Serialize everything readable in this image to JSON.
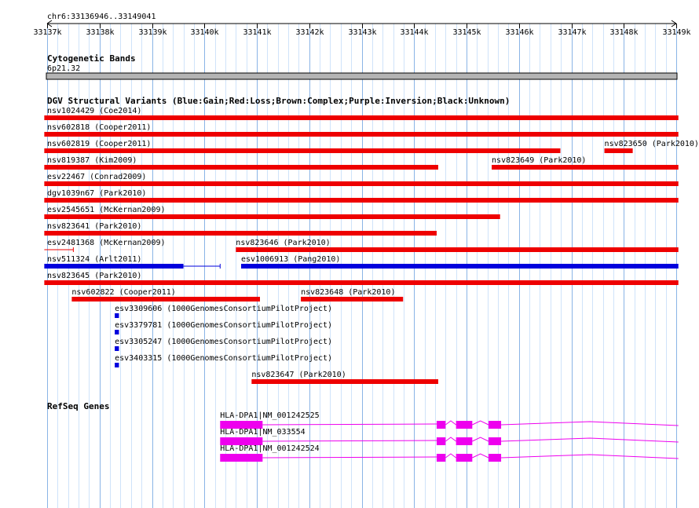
{
  "ruler": {
    "location": "chr6:33136946..33149041",
    "range": [
      33137000,
      33149000
    ],
    "ticks": [
      "33137k",
      "33138k",
      "33139k",
      "33140k",
      "33141k",
      "33142k",
      "33143k",
      "33144k",
      "33145k",
      "33146k",
      "33147k",
      "33148k",
      "33149k"
    ]
  },
  "cytoband": {
    "title": "Cytogenetic Bands",
    "band": "6p21.32"
  },
  "dgv": {
    "title": "DGV Structural Variants (Blue:Gain;Red:Loss;Brown:Complex;Purple:Inversion;Black:Unknown)",
    "colors": {
      "loss": "#ee0000",
      "gain": "#0000dd"
    },
    "variants": [
      {
        "label": "nsv1024429 (Coe2014)",
        "start": 33136946,
        "end": 33149041,
        "type": "loss",
        "row": 0
      },
      {
        "label": "nsv602818 (Cooper2011)",
        "start": 33136946,
        "end": 33149041,
        "type": "loss",
        "row": 1
      },
      {
        "label": "nsv602819 (Cooper2011)",
        "start": 33136946,
        "end": 33146790,
        "type": "loss",
        "row": 2
      },
      {
        "label": "nsv823650 (Park2010)",
        "start": 33147630,
        "end": 33148170,
        "type": "loss",
        "row": 2
      },
      {
        "label": "nsv819387 (Kim2009)",
        "start": 33136946,
        "end": 33144460,
        "type": "loss",
        "row": 3
      },
      {
        "label": "nsv823649 (Park2010)",
        "start": 33145480,
        "end": 33149041,
        "type": "loss",
        "row": 3
      },
      {
        "label": "esv22467 (Conrad2009)",
        "start": 33136946,
        "end": 33149041,
        "type": "loss",
        "row": 4
      },
      {
        "label": "dgv1039n67 (Park2010)",
        "start": 33136946,
        "end": 33149041,
        "type": "loss",
        "row": 5
      },
      {
        "label": "esv2545651 (McKernan2009)",
        "start": 33136946,
        "end": 33145640,
        "type": "loss",
        "row": 6
      },
      {
        "label": "nsv823641 (Park2010)",
        "start": 33136946,
        "end": 33144430,
        "type": "loss",
        "row": 7
      },
      {
        "label": "esv2481368 (McKernan2009)",
        "start": 33136946,
        "end": 33137500,
        "type": "loss",
        "row": 8,
        "thin": true
      },
      {
        "label": "nsv823646 (Park2010)",
        "start": 33140600,
        "end": 33149041,
        "type": "loss",
        "row": 8
      },
      {
        "label": "nsv511324 (Arlt2011)",
        "start": 33136946,
        "end": 33140300,
        "type": "gain",
        "row": 9,
        "thickEnd": 33139600
      },
      {
        "label": "esv1006913 (Pang2010)",
        "start": 33140700,
        "end": 33149041,
        "type": "gain",
        "row": 9
      },
      {
        "label": "nsv823645 (Park2010)",
        "start": 33136946,
        "end": 33149041,
        "type": "loss",
        "row": 10
      },
      {
        "label": "nsv602822 (Cooper2011)",
        "start": 33137470,
        "end": 33141060,
        "type": "loss",
        "row": 11
      },
      {
        "label": "nsv823648 (Park2010)",
        "start": 33141840,
        "end": 33143790,
        "type": "loss",
        "row": 11
      },
      {
        "label": "esv3309606 (1000GenomesConsortiumPilotProject)",
        "start": 33138290,
        "end": 33138370,
        "type": "gain",
        "row": 12
      },
      {
        "label": "esv3379781 (1000GenomesConsortiumPilotProject)",
        "start": 33138290,
        "end": 33138370,
        "type": "gain",
        "row": 13
      },
      {
        "label": "esv3305247 (1000GenomesConsortiumPilotProject)",
        "start": 33138290,
        "end": 33138370,
        "type": "gain",
        "row": 14
      },
      {
        "label": "esv3403315 (1000GenomesConsortiumPilotProject)",
        "start": 33138290,
        "end": 33138370,
        "type": "gain",
        "row": 15
      },
      {
        "label": "nsv823647 (Park2010)",
        "start": 33140900,
        "end": 33144460,
        "type": "loss",
        "row": 16
      }
    ]
  },
  "refseq": {
    "title": "RefSeq Genes",
    "color": "#ee00ee",
    "transcripts": [
      {
        "label": "HLA-DPA1|NM_001242525",
        "start": 33140300,
        "end": 33149041,
        "exons": [
          [
            33140300,
            33141110
          ],
          [
            33144430,
            33144600
          ],
          [
            33144800,
            33145110
          ],
          [
            33145420,
            33145660
          ]
        ]
      },
      {
        "label": "HLA-DPA1|NM_033554",
        "start": 33140300,
        "end": 33149041,
        "exons": [
          [
            33140300,
            33141110
          ],
          [
            33144430,
            33144600
          ],
          [
            33144800,
            33145110
          ],
          [
            33145420,
            33145660
          ]
        ]
      },
      {
        "label": "HLA-DPA1|NM_001242524",
        "start": 33140300,
        "end": 33149041,
        "exons": [
          [
            33140300,
            33141110
          ],
          [
            33144430,
            33144600
          ],
          [
            33144800,
            33145110
          ],
          [
            33145420,
            33145660
          ]
        ]
      }
    ]
  }
}
